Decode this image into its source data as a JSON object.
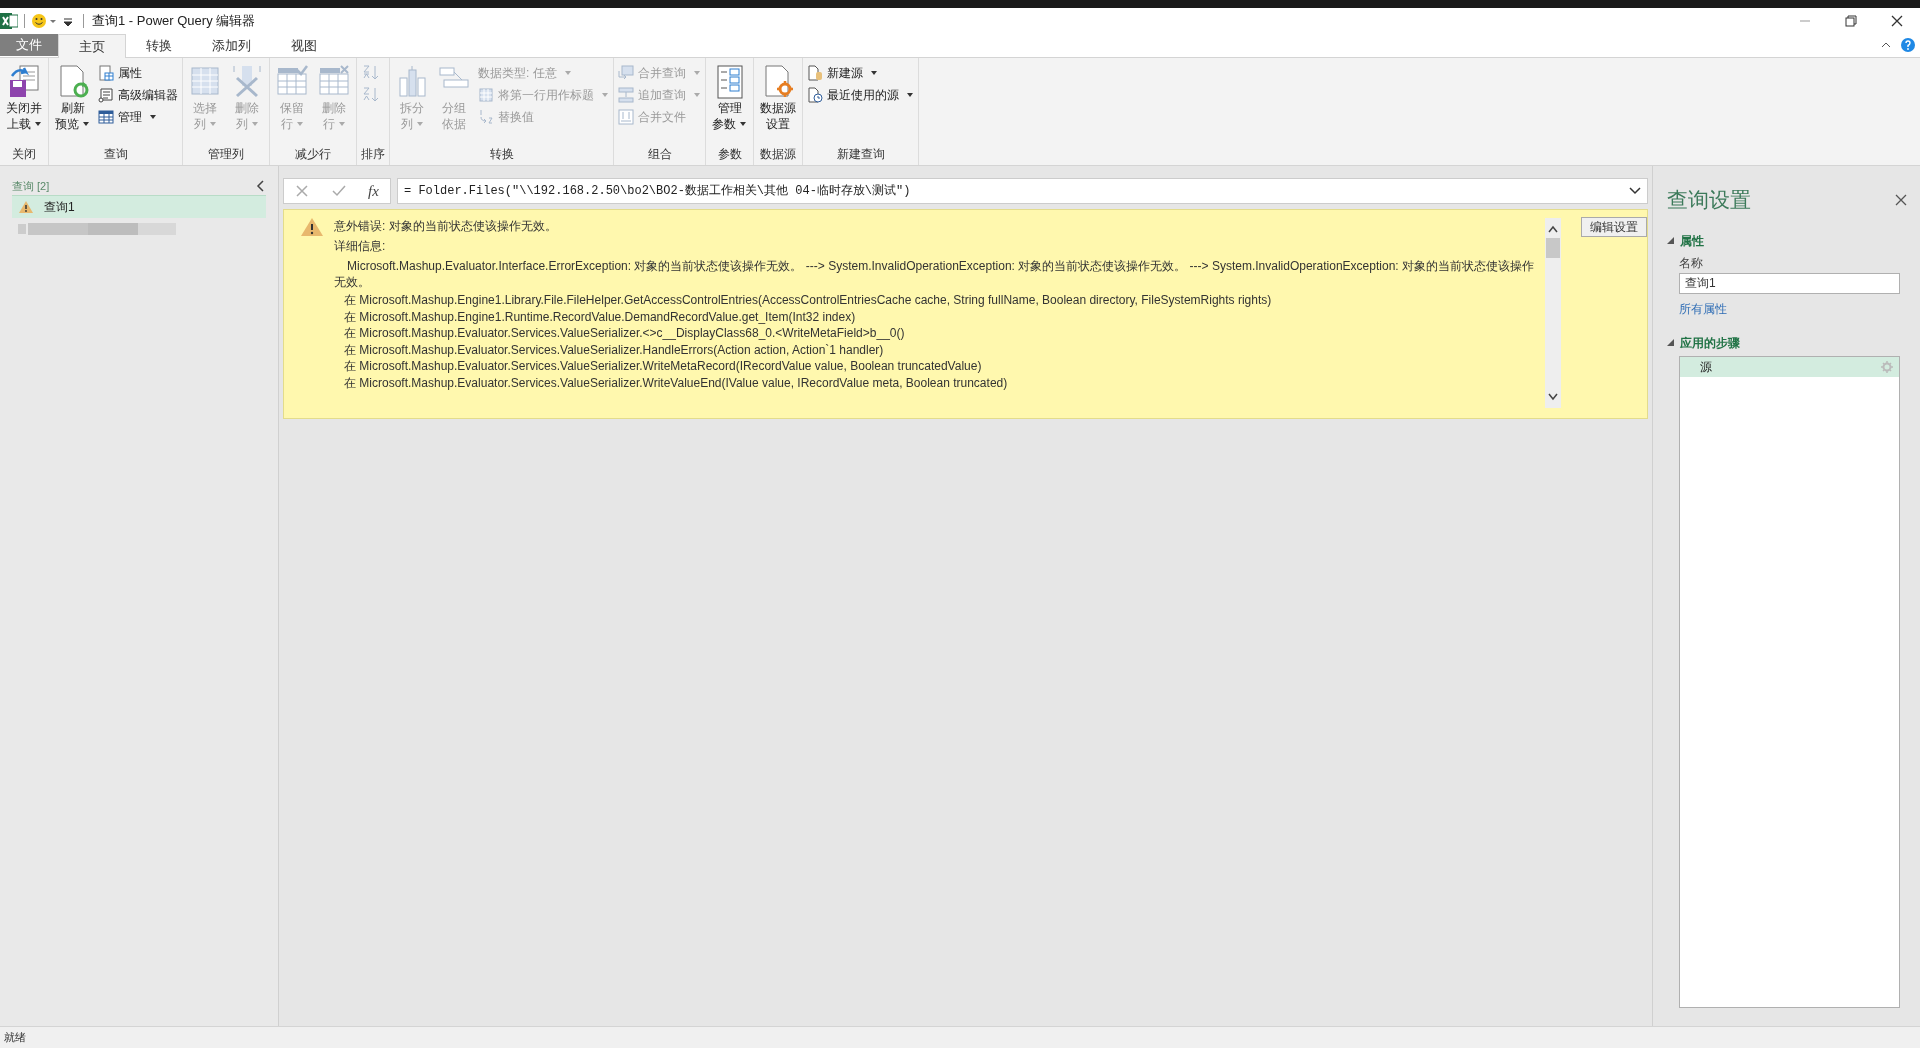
{
  "window": {
    "title": "查询1 - Power Query 编辑器"
  },
  "tabs": [
    {
      "label": "文件",
      "kind": "file",
      "selected": false
    },
    {
      "label": "主页",
      "kind": "tab",
      "selected": true
    },
    {
      "label": "转换",
      "kind": "tab",
      "selected": false
    },
    {
      "label": "添加列",
      "kind": "tab",
      "selected": false
    },
    {
      "label": "视图",
      "kind": "tab",
      "selected": false
    }
  ],
  "ribbon": {
    "groups": [
      {
        "label": "关闭",
        "items": [
          {
            "kind": "large",
            "lines": [
              "关闭并",
              "上载"
            ],
            "disabled": false,
            "dropdown": true
          }
        ]
      },
      {
        "label": "查询",
        "items": [
          {
            "kind": "large",
            "lines": [
              "刷新",
              "预览"
            ],
            "disabled": false,
            "dropdown": true
          },
          {
            "kind": "stack",
            "items": [
              {
                "label": "属性",
                "disabled": false,
                "dropdown": false
              },
              {
                "label": "高级编辑器",
                "disabled": false,
                "dropdown": false
              },
              {
                "label": "管理",
                "disabled": false,
                "dropdown": true
              }
            ]
          }
        ]
      },
      {
        "label": "管理列",
        "items": [
          {
            "kind": "large",
            "lines": [
              "选择",
              "列"
            ],
            "disabled": true,
            "dropdown": true
          },
          {
            "kind": "large",
            "lines": [
              "删除",
              "列"
            ],
            "disabled": true,
            "dropdown": true
          }
        ]
      },
      {
        "label": "减少行",
        "items": [
          {
            "kind": "large",
            "lines": [
              "保留",
              "行"
            ],
            "disabled": true,
            "dropdown": true
          },
          {
            "kind": "large",
            "lines": [
              "删除",
              "行"
            ],
            "disabled": true,
            "dropdown": true
          }
        ]
      },
      {
        "label": "排序",
        "items": [
          {
            "kind": "stack",
            "items": [
              {
                "disabled": true,
                "dropdown": false
              },
              {
                "disabled": true,
                "dropdown": false
              }
            ]
          }
        ]
      },
      {
        "label": "转换",
        "items": [
          {
            "kind": "large",
            "lines": [
              "拆分",
              "列"
            ],
            "disabled": true,
            "dropdown": true
          },
          {
            "kind": "large",
            "lines": [
              "分组",
              "依据"
            ],
            "disabled": true,
            "dropdown": false
          },
          {
            "kind": "stack",
            "items": [
              {
                "label": "数据类型: 任意",
                "disabled": true,
                "dropdown": true
              },
              {
                "label": "将第一行用作标题",
                "disabled": true,
                "dropdown": true
              },
              {
                "label": "替换值",
                "disabled": true,
                "dropdown": false
              }
            ]
          }
        ]
      },
      {
        "label": "组合",
        "items": [
          {
            "kind": "stack",
            "items": [
              {
                "label": "合并查询",
                "disabled": true,
                "dropdown": true
              },
              {
                "label": "追加查询",
                "disabled": true,
                "dropdown": true
              },
              {
                "label": "合并文件",
                "disabled": true,
                "dropdown": false
              }
            ]
          }
        ]
      },
      {
        "label": "参数",
        "items": [
          {
            "kind": "large",
            "lines": [
              "管理",
              "参数"
            ],
            "disabled": false,
            "dropdown": true
          }
        ]
      },
      {
        "label": "数据源",
        "items": [
          {
            "kind": "large",
            "lines": [
              "数据源",
              "设置"
            ],
            "disabled": false,
            "dropdown": false
          }
        ]
      },
      {
        "label": "新建查询",
        "items": [
          {
            "kind": "stack",
            "items": [
              {
                "label": "新建源",
                "disabled": false,
                "dropdown": true
              },
              {
                "label": "最近使用的源",
                "disabled": false,
                "dropdown": true
              }
            ]
          }
        ]
      }
    ]
  },
  "queries": {
    "header": "查询 [2]",
    "items": [
      {
        "kind": "error",
        "label": "查询1",
        "selected": true
      },
      {
        "kind": "blurred",
        "selected": false
      }
    ]
  },
  "formula_bar": {
    "fx": "fx",
    "formula": "= Folder.Files(\"\\\\192.168.2.50\\bo2\\BO2-数据工作相关\\其他 04-临时存放\\测试\")"
  },
  "error": {
    "title": "意外错误: 对象的当前状态使该操作无效。",
    "details_label": "详细信息:",
    "details": "Microsoft.Mashup.Evaluator.Interface.ErrorException: 对象的当前状态使该操作无效。 ---> System.InvalidOperationException: 对象的当前状态使该操作无效。 ---> System.InvalidOperationException: 对象的当前状态使该操作无效。",
    "stack": [
      "在 Microsoft.Mashup.Engine1.Library.File.FileHelper.GetAccessControlEntries(AccessControlEntriesCache cache, String fullName, Boolean directory, FileSystemRights rights)",
      "在 Microsoft.Mashup.Engine1.Runtime.RecordValue.DemandRecordValue.get_Item(Int32 index)",
      "在 Microsoft.Mashup.Evaluator.Services.ValueSerializer.<>c__DisplayClass68_0.<WriteMetaField>b__0()",
      "在 Microsoft.Mashup.Evaluator.Services.ValueSerializer.HandleErrors(Action action, Action`1 handler)",
      "在 Microsoft.Mashup.Evaluator.Services.ValueSerializer.WriteMetaRecord(IRecordValue value, Boolean truncatedValue)",
      "在 Microsoft.Mashup.Evaluator.Services.ValueSerializer.WriteValueEnd(IValue value, IRecordValue meta, Boolean truncated)"
    ],
    "button": "编辑设置"
  },
  "query_settings": {
    "title": "查询设置",
    "properties_header": "属性",
    "name_label": "名称",
    "name_value": "查询1",
    "all_properties_link": "所有属性",
    "steps_header": "应用的步骤",
    "steps": [
      {
        "label": "源",
        "selected": true
      }
    ]
  },
  "status_bar": {
    "text": "就绪"
  }
}
